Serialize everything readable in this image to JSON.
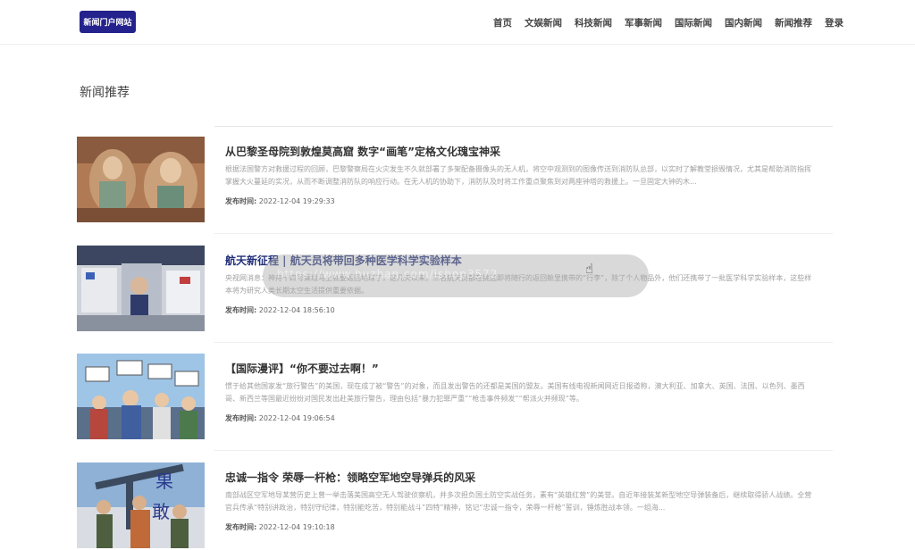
{
  "header": {
    "logo": "新闻门户网站",
    "nav": [
      "首页",
      "文娱新闻",
      "科技新闻",
      "军事新闻",
      "国际新闻",
      "国内新闻",
      "新闻推荐",
      "登录"
    ]
  },
  "section": {
    "title": "新闻推荐"
  },
  "articles": [
    {
      "title": "从巴黎圣母院到敦煌莫高窟 数字“画笔”定格文化瑰宝神采",
      "desc": "根据法国警方对救援过程的回顾，巴黎警察局在火灾发生不久就部署了多架配备摄像头的无人机，将空中观测到的图像传送到消防队总部，以实时了解教堂损毁情况，尤其是帮助消防指挥掌握大火蔓延的实况，从而不断调整消防队的响应行动。在无人机的协助下，消防队及时将工作重点聚焦到对两座钟塔的救援上。一旦固定大钟的木...",
      "meta_label": "发布时间:",
      "date": "2022-12-04 19:29:33"
    },
    {
      "title": "航天新征程 | 航天员将带回多种医学科学实验样本",
      "desc": "央视网消息：神舟十四号乘组马上就要返回地球了，这几天以来，三名航天员都在挑选即将随行的返回舱里携带的“行李”，除了个人物品外，他们还携带了一批医学科学实验样本，这些样本将为研究人类长期太空生活提供重要依据。",
      "meta_label": "发布时间:",
      "date": "2022-12-04 18:56:10"
    },
    {
      "title": "【国际漫评】“你不要过去啊！”",
      "desc": "惯于给其他国家发“旅行警告”的美国，现在成了被“警告”的对象，而且发出警告的还都是美国的盟友。美国有线电视新闻网近日报道称，澳大利亚、加拿大、英国、法国、以色列、墨西哥、新西兰等国最近纷纷对国民发出赴美旅行警告，理由包括“暴力犯罪严重”“枪击事件频发”“帮派火并频现”等。",
      "meta_label": "发布时间:",
      "date": "2022-12-04 19:06:54"
    },
    {
      "title": "忠诚一指令 荣辱一杆枪：领略空军地空导弹兵的风采",
      "desc": "南部战区空军地导某营历史上曾一举击落美国高空无人驾驶侦察机，并多次担负国土防空实战任务，素有“英雄红营”的美誉。自近年接装某新型地空导弹装备后，继续取得骄人战绩。全营官兵传承“特别讲政治，特别守纪律，特别能吃苦，特别能战斗”四特”精神，铭记“忠诚一指令，荣辱一杆枪”誓训，锤炼胜战本领。一组海...",
      "meta_label": "发布时间:",
      "date": "2022-12-04 19:10:18"
    }
  ],
  "watermark": "https://www.huzhan.com/ishop3572",
  "colors": {
    "logo_bg": "#24228c",
    "highlight_title": "#22307a"
  }
}
